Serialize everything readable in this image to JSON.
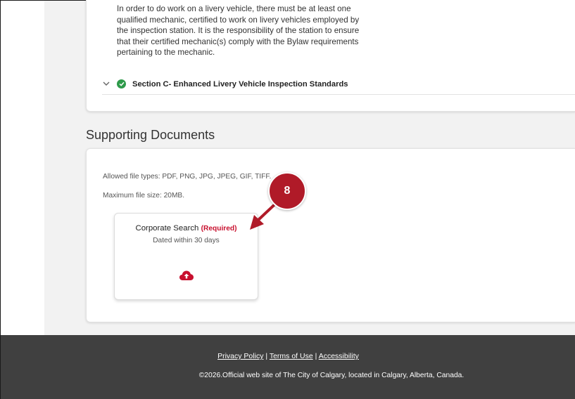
{
  "section_b": {
    "text": "In order to do work on a livery vehicle, there must be at least one qualified mechanic, certified to work on livery vehicles employed by the inspection station. It is the responsibility of the station to ensure that their certified mechanic(s) comply with the Bylaw requirements pertaining to the mechanic."
  },
  "section_c": {
    "label": "Section C- Enhanced Livery Vehicle Inspection Standards",
    "status_icon": "check-circle-icon",
    "expand_icon": "chevron-down-icon"
  },
  "supporting_documents": {
    "title": "Supporting Documents",
    "allowed_types": "Allowed file types: PDF, PNG, JPG, JPEG, GIF, TIFF.",
    "max_size": "Maximum file size: 20MB.",
    "upload": {
      "name": "Corporate Search",
      "required": "(Required)",
      "subtitle": "Dated within 30 days",
      "icon": "cloud-upload-icon"
    }
  },
  "annotation": {
    "step": "8",
    "color": "#b01a28"
  },
  "footer": {
    "privacy": "Privacy Policy",
    "separator": "|",
    "terms": "Terms of Use",
    "accessibility": "Accessibility",
    "copyright": "©2026.Official web site of The City of Calgary, located in Calgary, Alberta, Canada."
  },
  "colors": {
    "accent_red": "#c8102e",
    "success_green": "#2e9a4a",
    "footer_bg": "#404040"
  }
}
